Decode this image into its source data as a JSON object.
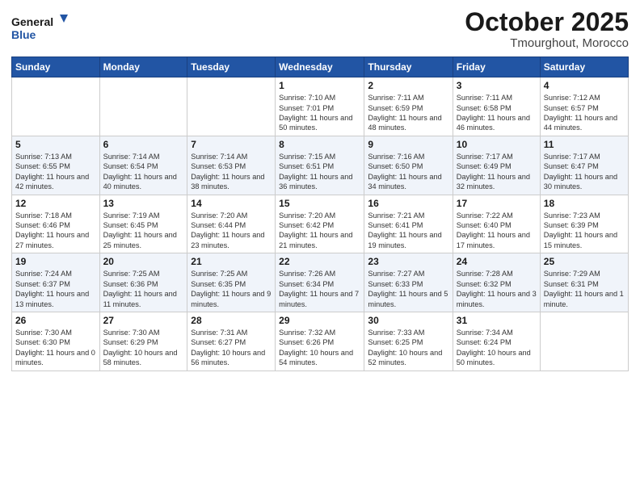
{
  "header": {
    "logo_line1": "General",
    "logo_line2": "Blue",
    "title": "October 2025",
    "subtitle": "Tmourghout, Morocco"
  },
  "days_of_week": [
    "Sunday",
    "Monday",
    "Tuesday",
    "Wednesday",
    "Thursday",
    "Friday",
    "Saturday"
  ],
  "weeks": [
    [
      {
        "num": "",
        "info": ""
      },
      {
        "num": "",
        "info": ""
      },
      {
        "num": "",
        "info": ""
      },
      {
        "num": "1",
        "info": "Sunrise: 7:10 AM\nSunset: 7:01 PM\nDaylight: 11 hours and 50 minutes."
      },
      {
        "num": "2",
        "info": "Sunrise: 7:11 AM\nSunset: 6:59 PM\nDaylight: 11 hours and 48 minutes."
      },
      {
        "num": "3",
        "info": "Sunrise: 7:11 AM\nSunset: 6:58 PM\nDaylight: 11 hours and 46 minutes."
      },
      {
        "num": "4",
        "info": "Sunrise: 7:12 AM\nSunset: 6:57 PM\nDaylight: 11 hours and 44 minutes."
      }
    ],
    [
      {
        "num": "5",
        "info": "Sunrise: 7:13 AM\nSunset: 6:55 PM\nDaylight: 11 hours and 42 minutes."
      },
      {
        "num": "6",
        "info": "Sunrise: 7:14 AM\nSunset: 6:54 PM\nDaylight: 11 hours and 40 minutes."
      },
      {
        "num": "7",
        "info": "Sunrise: 7:14 AM\nSunset: 6:53 PM\nDaylight: 11 hours and 38 minutes."
      },
      {
        "num": "8",
        "info": "Sunrise: 7:15 AM\nSunset: 6:51 PM\nDaylight: 11 hours and 36 minutes."
      },
      {
        "num": "9",
        "info": "Sunrise: 7:16 AM\nSunset: 6:50 PM\nDaylight: 11 hours and 34 minutes."
      },
      {
        "num": "10",
        "info": "Sunrise: 7:17 AM\nSunset: 6:49 PM\nDaylight: 11 hours and 32 minutes."
      },
      {
        "num": "11",
        "info": "Sunrise: 7:17 AM\nSunset: 6:47 PM\nDaylight: 11 hours and 30 minutes."
      }
    ],
    [
      {
        "num": "12",
        "info": "Sunrise: 7:18 AM\nSunset: 6:46 PM\nDaylight: 11 hours and 27 minutes."
      },
      {
        "num": "13",
        "info": "Sunrise: 7:19 AM\nSunset: 6:45 PM\nDaylight: 11 hours and 25 minutes."
      },
      {
        "num": "14",
        "info": "Sunrise: 7:20 AM\nSunset: 6:44 PM\nDaylight: 11 hours and 23 minutes."
      },
      {
        "num": "15",
        "info": "Sunrise: 7:20 AM\nSunset: 6:42 PM\nDaylight: 11 hours and 21 minutes."
      },
      {
        "num": "16",
        "info": "Sunrise: 7:21 AM\nSunset: 6:41 PM\nDaylight: 11 hours and 19 minutes."
      },
      {
        "num": "17",
        "info": "Sunrise: 7:22 AM\nSunset: 6:40 PM\nDaylight: 11 hours and 17 minutes."
      },
      {
        "num": "18",
        "info": "Sunrise: 7:23 AM\nSunset: 6:39 PM\nDaylight: 11 hours and 15 minutes."
      }
    ],
    [
      {
        "num": "19",
        "info": "Sunrise: 7:24 AM\nSunset: 6:37 PM\nDaylight: 11 hours and 13 minutes."
      },
      {
        "num": "20",
        "info": "Sunrise: 7:25 AM\nSunset: 6:36 PM\nDaylight: 11 hours and 11 minutes."
      },
      {
        "num": "21",
        "info": "Sunrise: 7:25 AM\nSunset: 6:35 PM\nDaylight: 11 hours and 9 minutes."
      },
      {
        "num": "22",
        "info": "Sunrise: 7:26 AM\nSunset: 6:34 PM\nDaylight: 11 hours and 7 minutes."
      },
      {
        "num": "23",
        "info": "Sunrise: 7:27 AM\nSunset: 6:33 PM\nDaylight: 11 hours and 5 minutes."
      },
      {
        "num": "24",
        "info": "Sunrise: 7:28 AM\nSunset: 6:32 PM\nDaylight: 11 hours and 3 minutes."
      },
      {
        "num": "25",
        "info": "Sunrise: 7:29 AM\nSunset: 6:31 PM\nDaylight: 11 hours and 1 minute."
      }
    ],
    [
      {
        "num": "26",
        "info": "Sunrise: 7:30 AM\nSunset: 6:30 PM\nDaylight: 11 hours and 0 minutes."
      },
      {
        "num": "27",
        "info": "Sunrise: 7:30 AM\nSunset: 6:29 PM\nDaylight: 10 hours and 58 minutes."
      },
      {
        "num": "28",
        "info": "Sunrise: 7:31 AM\nSunset: 6:27 PM\nDaylight: 10 hours and 56 minutes."
      },
      {
        "num": "29",
        "info": "Sunrise: 7:32 AM\nSunset: 6:26 PM\nDaylight: 10 hours and 54 minutes."
      },
      {
        "num": "30",
        "info": "Sunrise: 7:33 AM\nSunset: 6:25 PM\nDaylight: 10 hours and 52 minutes."
      },
      {
        "num": "31",
        "info": "Sunrise: 7:34 AM\nSunset: 6:24 PM\nDaylight: 10 hours and 50 minutes."
      },
      {
        "num": "",
        "info": ""
      }
    ]
  ]
}
